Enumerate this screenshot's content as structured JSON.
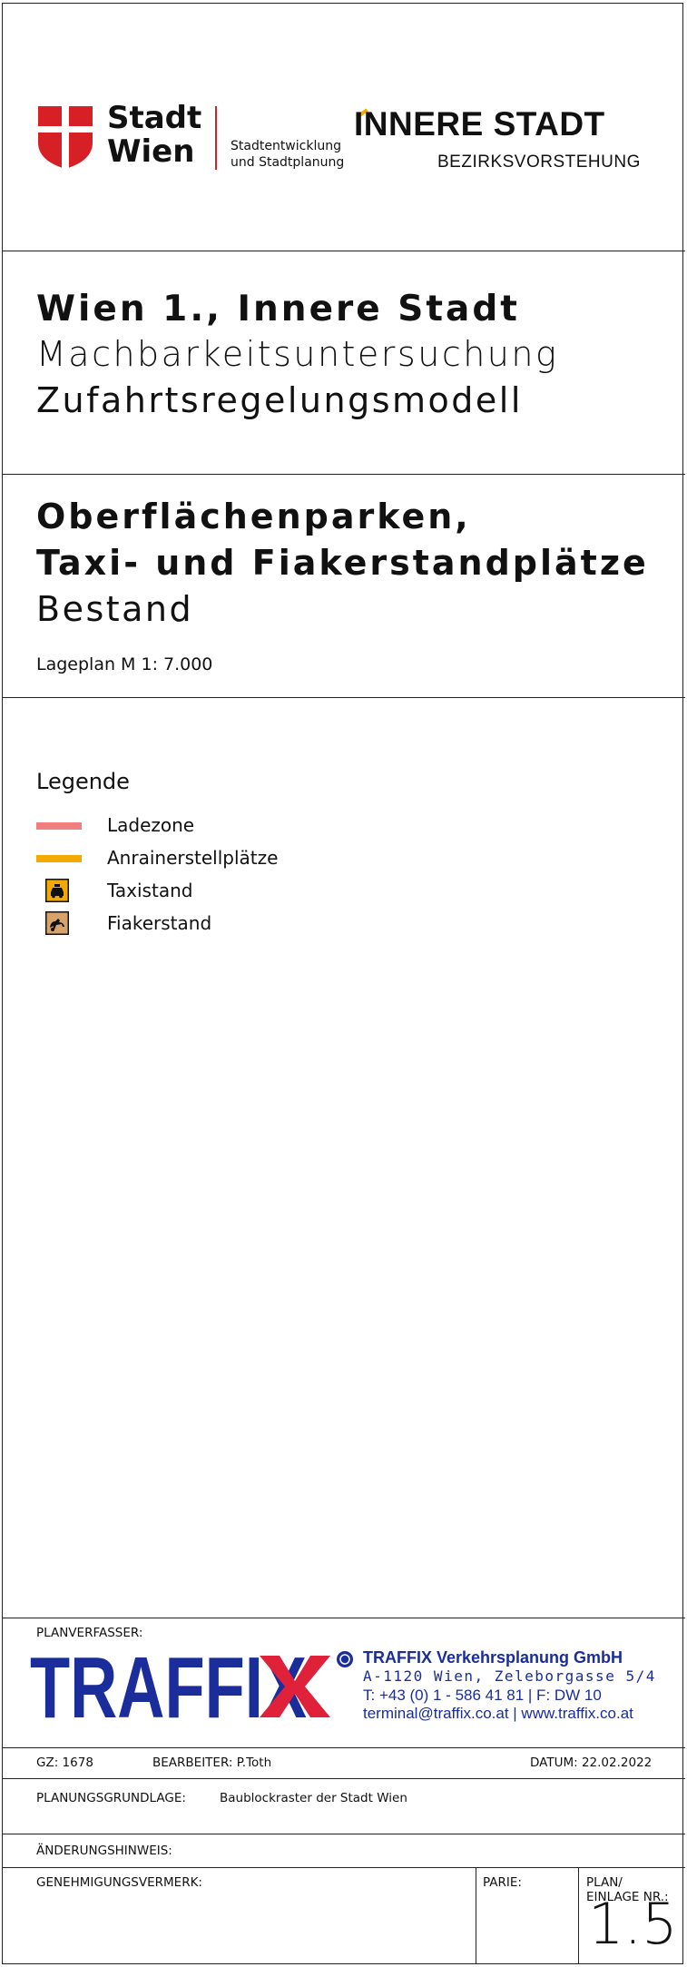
{
  "header": {
    "city_line1": "Stadt",
    "city_line2": "Wien",
    "department_line1": "Stadtentwicklung",
    "department_line2": "und Stadtplanung",
    "district": "INNERE STADT",
    "district_sub": "BEZIRKSVORSTEHUNG",
    "colors": {
      "wien_red": "#d71f26",
      "accent": "#f4a900"
    }
  },
  "title": {
    "line1": "Wien 1., Innere Stadt",
    "line2": "Machbarkeitsuntersuchung",
    "line3": "Zufahrtsregelungsmodell"
  },
  "subtitle": {
    "line1": "Oberflächenparken,",
    "line2": "Taxi- und Fiakerstandplätze",
    "line3": "Bestand",
    "scale": "Lageplan M 1: 7.000"
  },
  "legend": {
    "title": "Legende",
    "items": [
      {
        "label": "Ladezone",
        "symbol": "line",
        "color": "#f08080"
      },
      {
        "label": "Anrainerstellplätze",
        "symbol": "line",
        "color": "#f4a900"
      },
      {
        "label": "Taxistand",
        "symbol": "taxi-icon",
        "color": "#f4a900"
      },
      {
        "label": "Fiakerstand",
        "symbol": "horse-carriage-icon",
        "color": "#d8a36a"
      }
    ]
  },
  "footer": {
    "author_label": "PLANVERFASSER:",
    "logo_text": "TRAFFIX",
    "company_name": "TRAFFIX Verkehrsplanung GmbH",
    "address": "A-1120 Wien, Zeleborgasse 5/4",
    "phone": "T: +43 (0) 1 -  586 41 81  |  F: DW  10",
    "contact": "terminal@traffix.co.at | www.traffix.co.at",
    "gz": "GZ: 1678",
    "editor": "BEARBEITER: P.Toth",
    "date": "DATUM: 22.02.2022",
    "basis_label": "PLANUNGSGRUNDLAGE:",
    "basis_value": "Baublockraster der Stadt Wien",
    "change_label": "ÄNDERUNGSHINWEIS:",
    "approval_label": "GENEHMIGUNGSVERMERK:",
    "parie_label": "PARIE:",
    "plan_label1": "PLAN/",
    "plan_label2": "EINLAGE NR.:",
    "plan_number": "1.5",
    "colors": {
      "logo_blue": "#1a2d9a",
      "logo_red": "#e0213a"
    }
  }
}
